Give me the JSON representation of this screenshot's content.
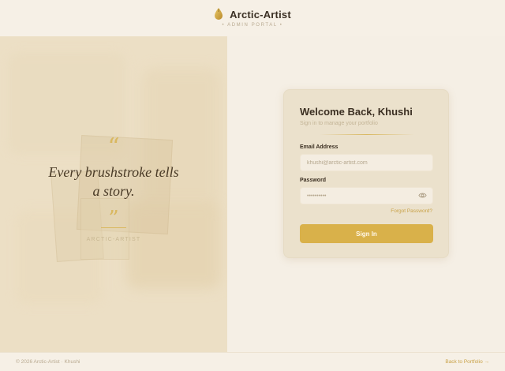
{
  "brand": {
    "name": "Arctic-Artist",
    "subtitle": "• ADMIN PORTAL •",
    "icon": "gold-drop-icon"
  },
  "art_panel": {
    "quote_open": "“",
    "quote_line1": "Every brushstroke tells",
    "quote_line2": "a story.",
    "quote_close": "”",
    "author": "ARCTIC-ARTIST"
  },
  "login": {
    "title": "Welcome Back, Khushi",
    "subtitle": "Sign in to manage your portfolio",
    "email_label": "Email Address",
    "email_placeholder": "khushi@arctic-artist.com",
    "password_label": "Password",
    "password_placeholder": "••••••••••",
    "forgot_label": "Forgot Password?",
    "submit_label": "Sign In"
  },
  "footer": {
    "copyright": "© 2026 Arctic-Artist · Khushi",
    "back_label": "Back to Portfolio →"
  },
  "colors": {
    "accent": "#d9b14a",
    "background": "#f5efe5",
    "card": "#ebe1cc",
    "text": "#3b2f22"
  }
}
